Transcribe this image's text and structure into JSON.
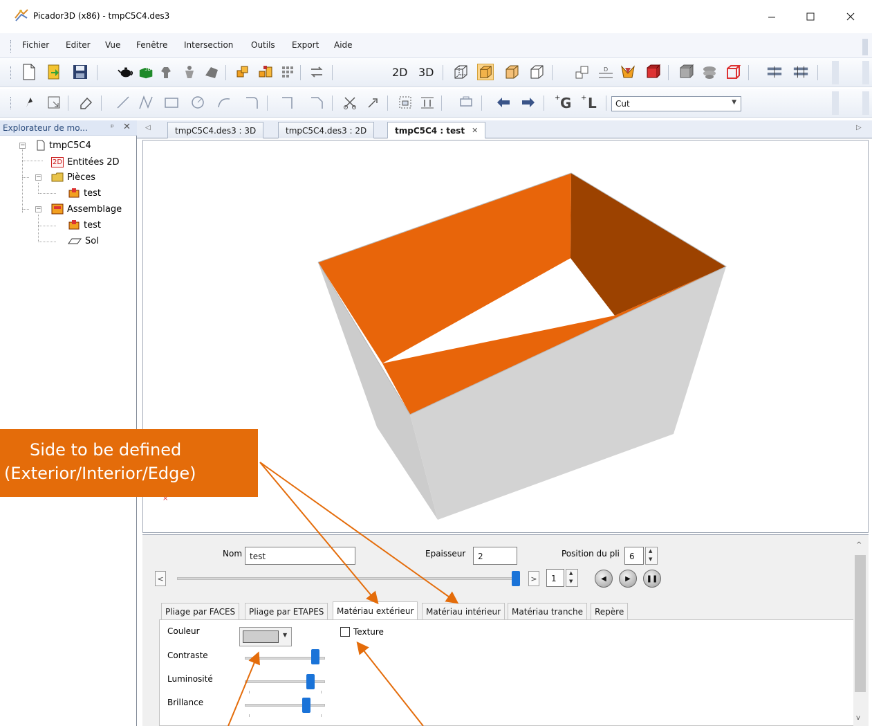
{
  "window": {
    "title": "Picador3D (x86) - tmpC5C4.des3",
    "minimize_icon": "minimize-icon",
    "maximize_icon": "maximize-icon",
    "close_icon": "close-icon"
  },
  "menu": {
    "items": [
      "Fichier",
      "Editer",
      "Vue",
      "Fenêtre",
      "Intersection",
      "Outils",
      "Export",
      "Aide"
    ]
  },
  "toolbar1": {
    "view_2d": "2D",
    "view_3d": "3D"
  },
  "toolbar2": {
    "g_label": "G",
    "l_label": "L",
    "cut_combo_value": "Cut"
  },
  "explorer": {
    "title": "Explorateur de mo...",
    "pin_glyph": "ᵖ",
    "close_glyph": "✕",
    "root": "tmpC5C4",
    "entities_badge": "2D",
    "entities": "Entitées 2D",
    "pieces": "Pièces",
    "piece_test": "test",
    "assembly": "Assemblage",
    "assembly_test": "test",
    "sol": "Sol"
  },
  "doc_tabs": {
    "tab_3d": "tmpC5C4.des3 : 3D",
    "tab_2d": "tmpC5C4.des3 : 2D",
    "tab_test": "tmpC5C4 : test",
    "close_glyph": "✕"
  },
  "viewport": {
    "face_orange": "#e8650a",
    "face_dark_orange": "#9c4200",
    "face_grey": "#cccccc",
    "face_grey_light": "#d3d3d3"
  },
  "properties": {
    "nom_label": "Nom",
    "nom_value": "test",
    "epaisseur_label": "Epaisseur",
    "epaisseur_value": "2",
    "position_label": "Position du pli",
    "position_value": "6",
    "step_value": "1",
    "prev_glyph": "<",
    "next_glyph": ">",
    "fold_progress": 1.0
  },
  "tabs": {
    "faces": "Pliage par FACES",
    "etapes": "Pliage par ETAPES",
    "exterieur": "Matériau extérieur",
    "interieur": "Matériau intérieur",
    "tranche": "Matériau tranche",
    "repere": "Repère"
  },
  "material": {
    "couleur_label": "Couleur",
    "couleur_value": "#cdcdcd",
    "texture_label": "Texture",
    "texture_checked": false,
    "contraste_label": "Contraste",
    "contraste_level": 0.88,
    "luminosite_label": "Luminosité",
    "luminosite_level": 0.82,
    "brillance_label": "Brillance",
    "brillance_level": 0.77
  },
  "annotation": {
    "line1": "Side to be defined",
    "line2": "(Exterior/Interior/Edge)",
    "color": "#e46c0a"
  }
}
